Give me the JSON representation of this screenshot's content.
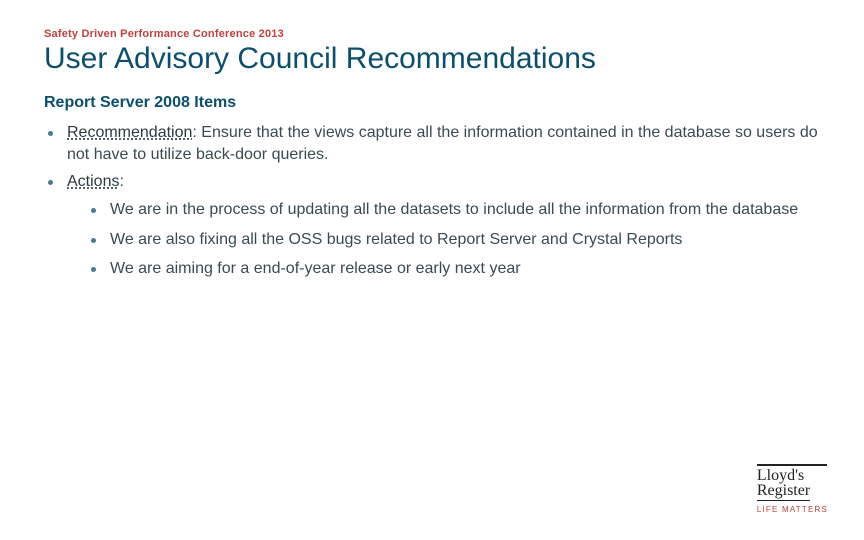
{
  "header": {
    "label": "Safety Driven Performance Conference 2013",
    "title": "User Advisory Council Recommendations"
  },
  "section": {
    "subtitle": "Report Server 2008 Items",
    "items": [
      {
        "label": "Recommendation",
        "text": ": Ensure that the views capture all the information contained in the database so users do not have to utilize back-door queries."
      },
      {
        "label": "Actions",
        "text": ":",
        "sub": [
          "We are in the process of updating all the datasets to include all the information from the database",
          "We are also fixing all the OSS bugs related to Report Server and Crystal Reports",
          "We are aiming for a end-of-year release or early next year"
        ]
      }
    ]
  },
  "logo": {
    "line1": "Lloyd's",
    "line2": "Register",
    "tagline": "LIFE MATTERS"
  }
}
